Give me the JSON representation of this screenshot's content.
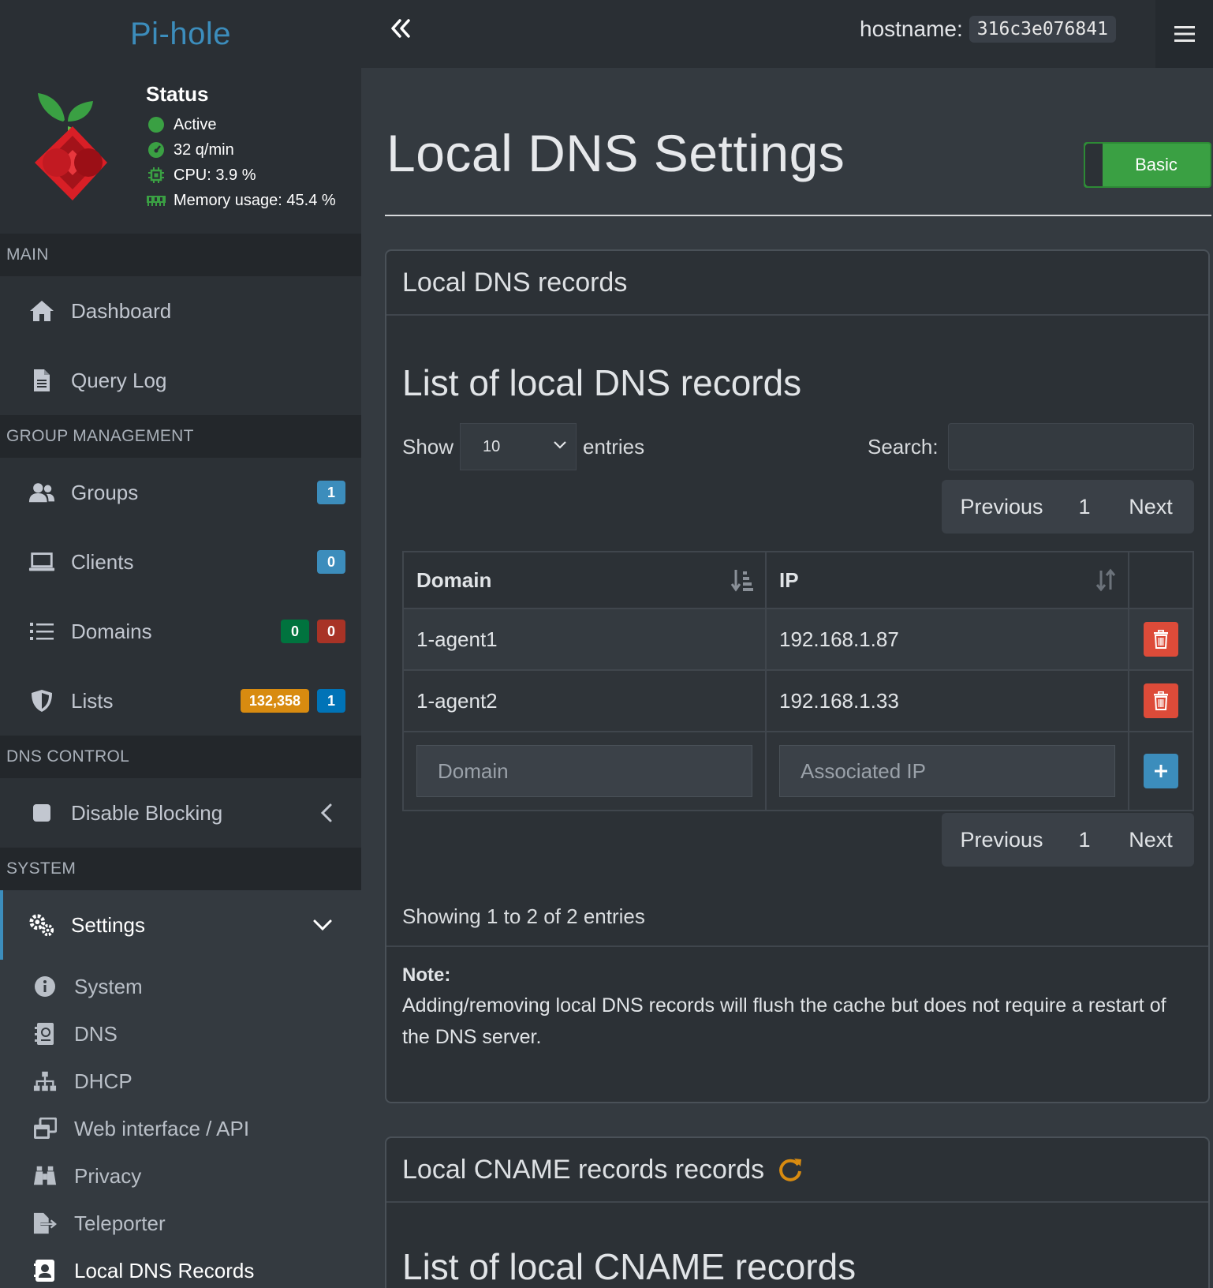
{
  "topbar": {
    "brand": "Pi-hole",
    "hostname_label": "hostname:",
    "hostname_value": "316c3e076841"
  },
  "status": {
    "title": "Status",
    "active": "Active",
    "queries": "32 q/min",
    "cpu": "CPU: 3.9 %",
    "memory": "Memory usage: 45.4 %"
  },
  "nav": {
    "main_header": "MAIN",
    "dashboard": "Dashboard",
    "query_log": "Query Log",
    "group_header": "GROUP MANAGEMENT",
    "groups": "Groups",
    "groups_badge": "1",
    "clients": "Clients",
    "clients_badge": "0",
    "domains": "Domains",
    "domains_badge_allow": "0",
    "domains_badge_deny": "0",
    "lists": "Lists",
    "lists_badge_count": "132,358",
    "lists_badge_lists": "1",
    "dns_header": "DNS CONTROL",
    "disable_blocking": "Disable Blocking",
    "system_header": "SYSTEM",
    "settings": "Settings",
    "sub": {
      "system": "System",
      "dns": "DNS",
      "dhcp": "DHCP",
      "web": "Web interface / API",
      "privacy": "Privacy",
      "teleporter": "Teleporter",
      "local_dns": "Local DNS Records"
    }
  },
  "page": {
    "title": "Local DNS Settings",
    "mode": "Basic"
  },
  "dns_card": {
    "header": "Local DNS records",
    "list_title": "List of local DNS records",
    "show": "Show",
    "entries_select": "10",
    "entries": "entries",
    "search_label": "Search:",
    "pager": {
      "previous": "Previous",
      "page": "1",
      "next": "Next"
    },
    "columns": {
      "domain": "Domain",
      "ip": "IP"
    },
    "rows": [
      {
        "domain": "1-agent1",
        "ip": "192.168.1.87"
      },
      {
        "domain": "1-agent2",
        "ip": "192.168.1.33"
      }
    ],
    "domain_placeholder": "Domain",
    "ip_placeholder": "Associated IP",
    "info": "Showing 1 to 2 of 2 entries",
    "note_title": "Note:",
    "note_body": "Adding/removing local DNS records will flush the cache but does not require a restart of the DNS server."
  },
  "cname_card": {
    "header": "Local CNAME records records",
    "list_title": "List of local CNAME records"
  },
  "colors": {
    "accent": "#3c8dbc",
    "success": "#3aa043",
    "danger": "#dd4b39",
    "warning": "#d88b10"
  }
}
